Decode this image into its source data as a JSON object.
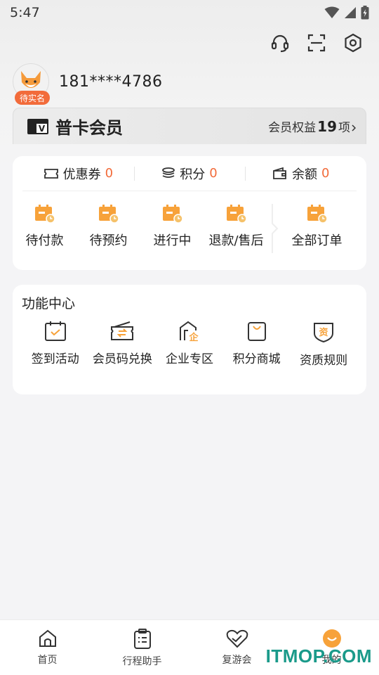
{
  "status_bar": {
    "time": "5:47"
  },
  "header": {
    "icons": [
      "headset-icon",
      "scan-icon",
      "settings-icon"
    ]
  },
  "profile": {
    "badge": "待实名",
    "phone": "181****4786"
  },
  "member": {
    "logo": "V",
    "title": "普卡会员",
    "rights_label": "会员权益",
    "rights_count": "19",
    "rights_unit": "项"
  },
  "stats": [
    {
      "label": "优惠券",
      "value": "0"
    },
    {
      "label": "积分",
      "value": "0"
    },
    {
      "label": "余额",
      "value": "0"
    }
  ],
  "orders": [
    {
      "label": "待付款"
    },
    {
      "label": "待预约"
    },
    {
      "label": "进行中"
    },
    {
      "label": "退款/售后"
    },
    {
      "label": "全部订单"
    }
  ],
  "function_center": {
    "title": "功能中心",
    "items": [
      {
        "label": "签到活动"
      },
      {
        "label": "会员码兑换"
      },
      {
        "label": "企业专区"
      },
      {
        "label": "积分商城"
      },
      {
        "label": "资质规则"
      }
    ]
  },
  "bottom_nav": [
    {
      "label": "首页"
    },
    {
      "label": "行程助手"
    },
    {
      "label": "复游会"
    },
    {
      "label": "我的"
    }
  ],
  "watermark": "ITMOP.COM",
  "colors": {
    "accent": "#f26b3a",
    "icon_orange": "#f7a23a",
    "watermark": "#1a9a8a"
  }
}
